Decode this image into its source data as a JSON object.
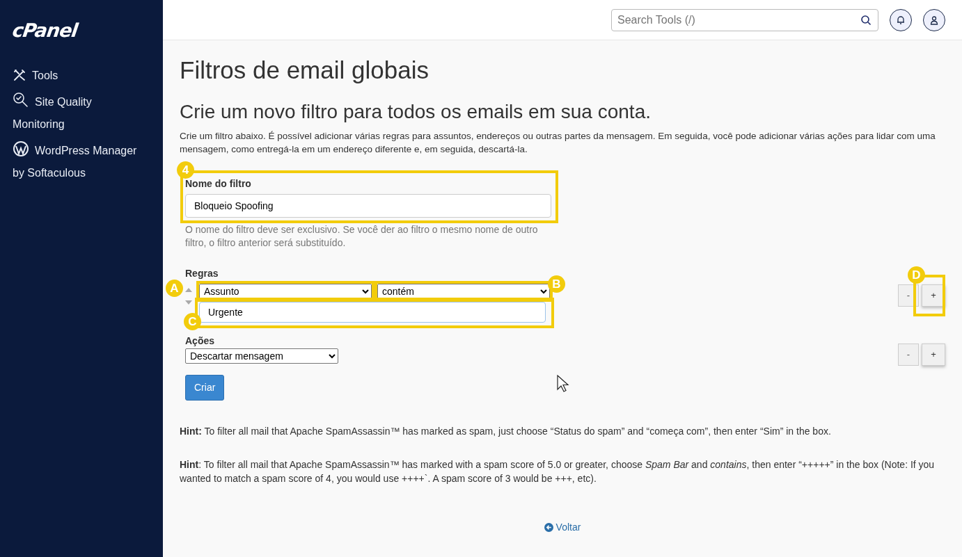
{
  "sidebar": {
    "logo": "cPanel",
    "items": [
      {
        "label": "Tools"
      },
      {
        "label": "Site Quality Monitoring"
      },
      {
        "label": "WordPress Manager by Softaculous"
      }
    ]
  },
  "header": {
    "search": {
      "placeholder": "Search Tools (/)"
    }
  },
  "page": {
    "title": "Filtros de email globais",
    "subtitle": "Crie um novo filtro para todos os emails em sua conta.",
    "intro": "Crie um filtro abaixo. É possível adicionar várias regras para assuntos, endereços ou outras partes da mensagem. Em seguida, você pode adicionar várias ações para lidar com uma mensagem, como entregá-la em um endereço diferente e, em seguida, descartá-la."
  },
  "filter_name": {
    "label": "Nome do filtro",
    "value": "Bloqueio Spoofing",
    "help": "O nome do filtro deve ser exclusivo. Se você der ao filtro o mesmo nome de outro filtro, o filtro anterior será substituído.",
    "callout": "4"
  },
  "rules": {
    "label": "Regras",
    "part": {
      "value": "Assunto",
      "callout": "A"
    },
    "match": {
      "value": "contém",
      "callout": "B"
    },
    "text": {
      "value": "Urgente",
      "callout": "C"
    },
    "remove_button": "-",
    "add_button": "+",
    "add_callout": "D"
  },
  "actions": {
    "label": "Ações",
    "action": "Descartar mensagem",
    "remove_button": "-",
    "add_button": "+"
  },
  "create_button": "Criar",
  "hints": [
    "**Hint:** To filter all mail that Apache SpamAssassin™ has marked as spam, just choose “Status do spam” and “começa com”, then enter “Sim” in the box.",
    "**Hint**: To filter all mail that Apache SpamAssassin™ has marked with a spam score of 5.0 or greater, choose *Spam Bar* and *contains*, then enter “+++++” in the box (Note: If you wanted to match a spam score of 4, you would use ++++`. A spam score of 3 would be +++, etc)."
  ],
  "back_link": "Voltar"
}
